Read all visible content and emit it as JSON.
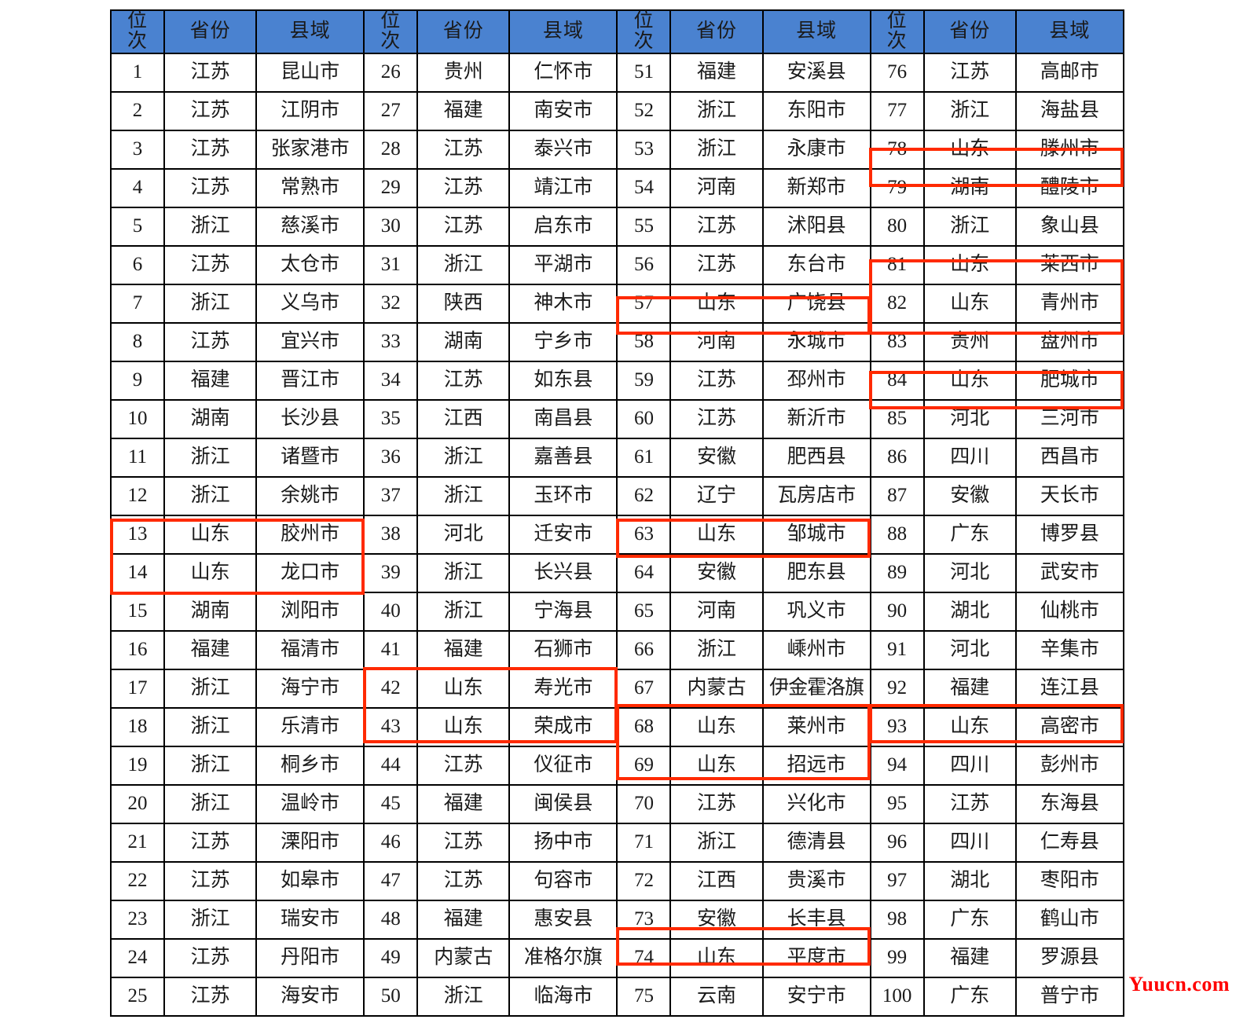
{
  "table": {
    "headers": {
      "rank": "位次",
      "rank_chars": [
        "位",
        "次"
      ],
      "province": "省份",
      "county": "县域"
    },
    "block_count": 4,
    "rows_per_block": 25,
    "highlight_color": "#FF2A00",
    "header_bg": "#4A82D0",
    "highlighted_ranks": [
      13,
      14,
      42,
      43,
      57,
      63,
      68,
      69,
      74,
      78,
      81,
      82,
      84,
      93
    ],
    "rows": [
      {
        "rank": "1",
        "province": "江苏",
        "county": "昆山市",
        "highlight": false
      },
      {
        "rank": "2",
        "province": "江苏",
        "county": "江阴市",
        "highlight": false
      },
      {
        "rank": "3",
        "province": "江苏",
        "county": "张家港市",
        "highlight": false
      },
      {
        "rank": "4",
        "province": "江苏",
        "county": "常熟市",
        "highlight": false
      },
      {
        "rank": "5",
        "province": "浙江",
        "county": "慈溪市",
        "highlight": false
      },
      {
        "rank": "6",
        "province": "江苏",
        "county": "太仓市",
        "highlight": false
      },
      {
        "rank": "7",
        "province": "浙江",
        "county": "义乌市",
        "highlight": false
      },
      {
        "rank": "8",
        "province": "江苏",
        "county": "宜兴市",
        "highlight": false
      },
      {
        "rank": "9",
        "province": "福建",
        "county": "晋江市",
        "highlight": false
      },
      {
        "rank": "10",
        "province": "湖南",
        "county": "长沙县",
        "highlight": false
      },
      {
        "rank": "11",
        "province": "浙江",
        "county": "诸暨市",
        "highlight": false
      },
      {
        "rank": "12",
        "province": "浙江",
        "county": "余姚市",
        "highlight": false
      },
      {
        "rank": "13",
        "province": "山东",
        "county": "胶州市",
        "highlight": true
      },
      {
        "rank": "14",
        "province": "山东",
        "county": "龙口市",
        "highlight": true
      },
      {
        "rank": "15",
        "province": "湖南",
        "county": "浏阳市",
        "highlight": false
      },
      {
        "rank": "16",
        "province": "福建",
        "county": "福清市",
        "highlight": false
      },
      {
        "rank": "17",
        "province": "浙江",
        "county": "海宁市",
        "highlight": false
      },
      {
        "rank": "18",
        "province": "浙江",
        "county": "乐清市",
        "highlight": false
      },
      {
        "rank": "19",
        "province": "浙江",
        "county": "桐乡市",
        "highlight": false
      },
      {
        "rank": "20",
        "province": "浙江",
        "county": "温岭市",
        "highlight": false
      },
      {
        "rank": "21",
        "province": "江苏",
        "county": "溧阳市",
        "highlight": false
      },
      {
        "rank": "22",
        "province": "江苏",
        "county": "如皋市",
        "highlight": false
      },
      {
        "rank": "23",
        "province": "浙江",
        "county": "瑞安市",
        "highlight": false
      },
      {
        "rank": "24",
        "province": "江苏",
        "county": "丹阳市",
        "highlight": false
      },
      {
        "rank": "25",
        "province": "江苏",
        "county": "海安市",
        "highlight": false
      },
      {
        "rank": "26",
        "province": "贵州",
        "county": "仁怀市",
        "highlight": false
      },
      {
        "rank": "27",
        "province": "福建",
        "county": "南安市",
        "highlight": false
      },
      {
        "rank": "28",
        "province": "江苏",
        "county": "泰兴市",
        "highlight": false
      },
      {
        "rank": "29",
        "province": "江苏",
        "county": "靖江市",
        "highlight": false
      },
      {
        "rank": "30",
        "province": "江苏",
        "county": "启东市",
        "highlight": false
      },
      {
        "rank": "31",
        "province": "浙江",
        "county": "平湖市",
        "highlight": false
      },
      {
        "rank": "32",
        "province": "陕西",
        "county": "神木市",
        "highlight": false
      },
      {
        "rank": "33",
        "province": "湖南",
        "county": "宁乡市",
        "highlight": false
      },
      {
        "rank": "34",
        "province": "江苏",
        "county": "如东县",
        "highlight": false
      },
      {
        "rank": "35",
        "province": "江西",
        "county": "南昌县",
        "highlight": false
      },
      {
        "rank": "36",
        "province": "浙江",
        "county": "嘉善县",
        "highlight": false
      },
      {
        "rank": "37",
        "province": "浙江",
        "county": "玉环市",
        "highlight": false
      },
      {
        "rank": "38",
        "province": "河北",
        "county": "迁安市",
        "highlight": false
      },
      {
        "rank": "39",
        "province": "浙江",
        "county": "长兴县",
        "highlight": false
      },
      {
        "rank": "40",
        "province": "浙江",
        "county": "宁海县",
        "highlight": false
      },
      {
        "rank": "41",
        "province": "福建",
        "county": "石狮市",
        "highlight": false
      },
      {
        "rank": "42",
        "province": "山东",
        "county": "寿光市",
        "highlight": true
      },
      {
        "rank": "43",
        "province": "山东",
        "county": "荣成市",
        "highlight": true
      },
      {
        "rank": "44",
        "province": "江苏",
        "county": "仪征市",
        "highlight": false
      },
      {
        "rank": "45",
        "province": "福建",
        "county": "闽侯县",
        "highlight": false
      },
      {
        "rank": "46",
        "province": "江苏",
        "county": "扬中市",
        "highlight": false
      },
      {
        "rank": "47",
        "province": "江苏",
        "county": "句容市",
        "highlight": false
      },
      {
        "rank": "48",
        "province": "福建",
        "county": "惠安县",
        "highlight": false
      },
      {
        "rank": "49",
        "province": "内蒙古",
        "county": "准格尔旗",
        "highlight": false
      },
      {
        "rank": "50",
        "province": "浙江",
        "county": "临海市",
        "highlight": false
      },
      {
        "rank": "51",
        "province": "福建",
        "county": "安溪县",
        "highlight": false
      },
      {
        "rank": "52",
        "province": "浙江",
        "county": "东阳市",
        "highlight": false
      },
      {
        "rank": "53",
        "province": "浙江",
        "county": "永康市",
        "highlight": false
      },
      {
        "rank": "54",
        "province": "河南",
        "county": "新郑市",
        "highlight": false
      },
      {
        "rank": "55",
        "province": "江苏",
        "county": "沭阳县",
        "highlight": false
      },
      {
        "rank": "56",
        "province": "江苏",
        "county": "东台市",
        "highlight": false
      },
      {
        "rank": "57",
        "province": "山东",
        "county": "广饶县",
        "highlight": true
      },
      {
        "rank": "58",
        "province": "河南",
        "county": "永城市",
        "highlight": false
      },
      {
        "rank": "59",
        "province": "江苏",
        "county": "邳州市",
        "highlight": false
      },
      {
        "rank": "60",
        "province": "江苏",
        "county": "新沂市",
        "highlight": false
      },
      {
        "rank": "61",
        "province": "安徽",
        "county": "肥西县",
        "highlight": false
      },
      {
        "rank": "62",
        "province": "辽宁",
        "county": "瓦房店市",
        "highlight": false
      },
      {
        "rank": "63",
        "province": "山东",
        "county": "邹城市",
        "highlight": true
      },
      {
        "rank": "64",
        "province": "安徽",
        "county": "肥东县",
        "highlight": false
      },
      {
        "rank": "65",
        "province": "河南",
        "county": "巩义市",
        "highlight": false
      },
      {
        "rank": "66",
        "province": "浙江",
        "county": "嵊州市",
        "highlight": false
      },
      {
        "rank": "67",
        "province": "内蒙古",
        "county": "伊金霍洛旗",
        "highlight": false
      },
      {
        "rank": "68",
        "province": "山东",
        "county": "莱州市",
        "highlight": true
      },
      {
        "rank": "69",
        "province": "山东",
        "county": "招远市",
        "highlight": true
      },
      {
        "rank": "70",
        "province": "江苏",
        "county": "兴化市",
        "highlight": false
      },
      {
        "rank": "71",
        "province": "浙江",
        "county": "德清县",
        "highlight": false
      },
      {
        "rank": "72",
        "province": "江西",
        "county": "贵溪市",
        "highlight": false
      },
      {
        "rank": "73",
        "province": "安徽",
        "county": "长丰县",
        "highlight": false
      },
      {
        "rank": "74",
        "province": "山东",
        "county": "平度市",
        "highlight": true
      },
      {
        "rank": "75",
        "province": "云南",
        "county": "安宁市",
        "highlight": false
      },
      {
        "rank": "76",
        "province": "江苏",
        "county": "高邮市",
        "highlight": false
      },
      {
        "rank": "77",
        "province": "浙江",
        "county": "海盐县",
        "highlight": false
      },
      {
        "rank": "78",
        "province": "山东",
        "county": "滕州市",
        "highlight": true
      },
      {
        "rank": "79",
        "province": "湖南",
        "county": "醴陵市",
        "highlight": false
      },
      {
        "rank": "80",
        "province": "浙江",
        "county": "象山县",
        "highlight": false
      },
      {
        "rank": "81",
        "province": "山东",
        "county": "莱西市",
        "highlight": true
      },
      {
        "rank": "82",
        "province": "山东",
        "county": "青州市",
        "highlight": true
      },
      {
        "rank": "83",
        "province": "贵州",
        "county": "盘州市",
        "highlight": false
      },
      {
        "rank": "84",
        "province": "山东",
        "county": "肥城市",
        "highlight": true
      },
      {
        "rank": "85",
        "province": "河北",
        "county": "三河市",
        "highlight": false
      },
      {
        "rank": "86",
        "province": "四川",
        "county": "西昌市",
        "highlight": false
      },
      {
        "rank": "87",
        "province": "安徽",
        "county": "天长市",
        "highlight": false
      },
      {
        "rank": "88",
        "province": "广东",
        "county": "博罗县",
        "highlight": false
      },
      {
        "rank": "89",
        "province": "河北",
        "county": "武安市",
        "highlight": false
      },
      {
        "rank": "90",
        "province": "湖北",
        "county": "仙桃市",
        "highlight": false
      },
      {
        "rank": "91",
        "province": "河北",
        "county": "辛集市",
        "highlight": false
      },
      {
        "rank": "92",
        "province": "福建",
        "county": "连江县",
        "highlight": false
      },
      {
        "rank": "93",
        "province": "山东",
        "county": "高密市",
        "highlight": true
      },
      {
        "rank": "94",
        "province": "四川",
        "county": "彭州市",
        "highlight": false
      },
      {
        "rank": "95",
        "province": "江苏",
        "county": "东海县",
        "highlight": false
      },
      {
        "rank": "96",
        "province": "四川",
        "county": "仁寿县",
        "highlight": false
      },
      {
        "rank": "97",
        "province": "湖北",
        "county": "枣阳市",
        "highlight": false
      },
      {
        "rank": "98",
        "province": "广东",
        "county": "鹤山市",
        "highlight": false
      },
      {
        "rank": "99",
        "province": "福建",
        "county": "罗源县",
        "highlight": false
      },
      {
        "rank": "100",
        "province": "广东",
        "county": "普宁市",
        "highlight": false
      }
    ]
  },
  "watermark": {
    "text": "Yuucn.com",
    "color": "#FF0000"
  }
}
